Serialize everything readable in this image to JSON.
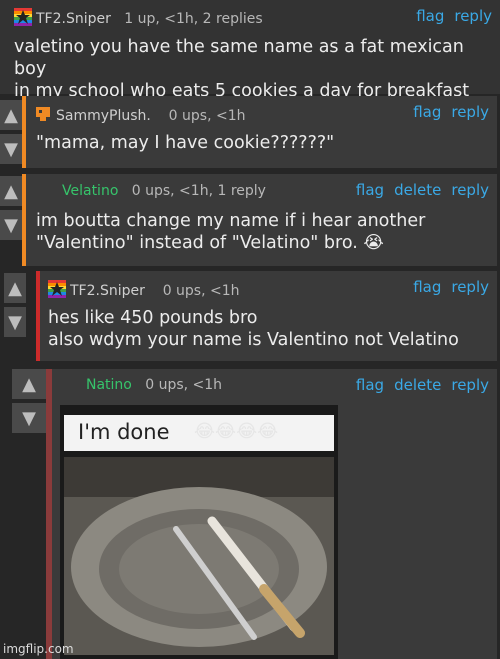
{
  "comments": [
    {
      "username": "TF2.Sniper",
      "meta": "1 up, <1h, 2 replies",
      "body": "valetino you have the same name as a fat mexican boy\nin my school who eats 5 cookies a day for breakfast",
      "actions": [
        "flag",
        "reply"
      ]
    },
    {
      "username": "SammyPlush.",
      "meta": "0 ups, <1h",
      "body": "\"mama, may I have cookie??????\"",
      "actions": [
        "flag",
        "reply"
      ]
    },
    {
      "username": "Velatino",
      "meta": "0 ups, <1h, 1 reply",
      "body": "im boutta change my name if i hear another\n\"Valentino\" instead of \"Velatino\" bro. 😭",
      "actions": [
        "flag",
        "delete",
        "reply"
      ]
    },
    {
      "username": "TF2.Sniper",
      "meta": "0 ups, <1h",
      "body": "hes like 450 pounds bro\nalso wdym your name is Valentino not Velatino",
      "actions": [
        "flag",
        "reply"
      ]
    },
    {
      "username": "Natino",
      "meta": "0 ups, <1h",
      "body": "",
      "actions": [
        "flag",
        "delete",
        "reply"
      ]
    }
  ],
  "meme": {
    "caption": "I'm done",
    "emojis": "😂😂😂😂"
  },
  "watermark": "imgflip.com",
  "colors": {
    "accent_orange": "#f08a24",
    "accent_red": "#cc2b2b",
    "accent_maroon": "#8a3b3b",
    "username_green": "#36c46b",
    "link_blue": "#3aa9e6"
  }
}
